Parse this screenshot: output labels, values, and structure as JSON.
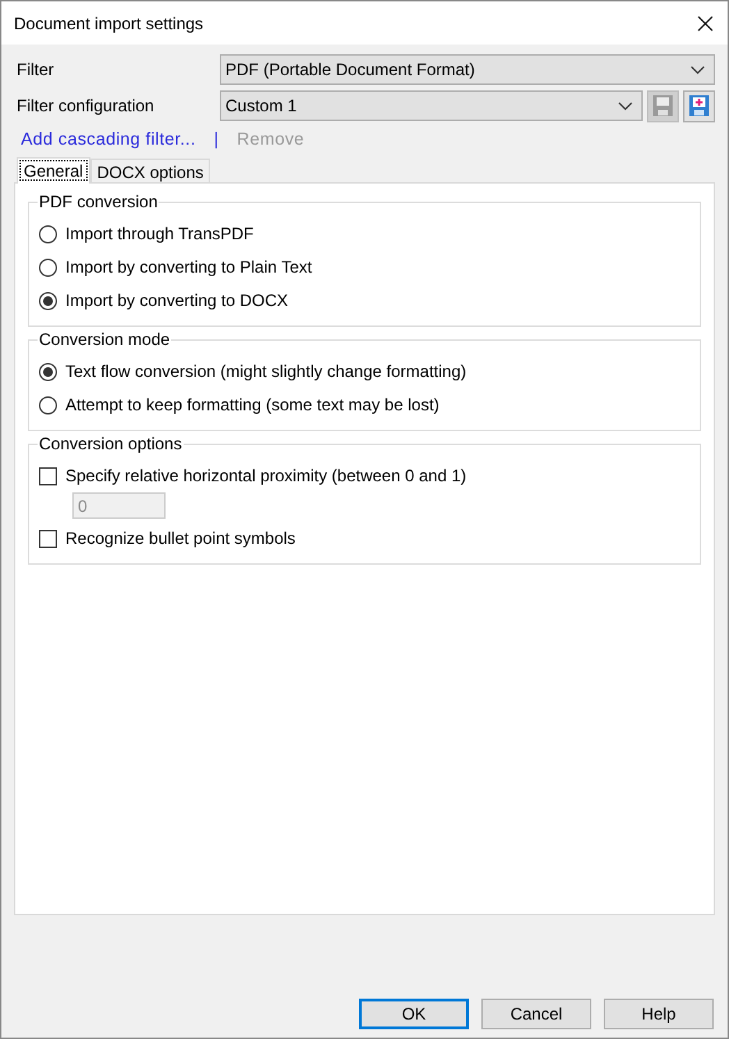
{
  "window": {
    "title": "Document import settings"
  },
  "filter": {
    "label": "Filter",
    "value": "PDF (Portable Document Format)"
  },
  "filter_configuration": {
    "label": "Filter configuration",
    "value": "Custom 1",
    "save_disabled": true
  },
  "links": [
    {
      "label": "Add cascading filter...",
      "disabled": false
    },
    {
      "label": "Remove",
      "disabled": true
    }
  ],
  "link_separator": "|",
  "tabs": [
    {
      "label": "General",
      "selected": true
    },
    {
      "label": "DOCX options",
      "selected": false
    }
  ],
  "groups": [
    {
      "title": "PDF conversion",
      "items": [
        {
          "kind": "radio",
          "label": "Import through TransPDF",
          "selected": false
        },
        {
          "kind": "radio",
          "label": "Import by converting to Plain Text",
          "selected": false
        },
        {
          "kind": "radio",
          "label": "Import by converting to DOCX",
          "selected": true
        }
      ]
    },
    {
      "title": "Conversion mode",
      "items": [
        {
          "kind": "radio",
          "label": "Text flow conversion (might slightly change formatting)",
          "selected": true
        },
        {
          "kind": "radio",
          "label": "Attempt to keep formatting (some text may be lost)",
          "selected": false
        }
      ]
    },
    {
      "title": "Conversion options",
      "items": [
        {
          "kind": "checkbox",
          "label": "Specify relative horizontal proximity (between 0 and 1)",
          "checked": false,
          "field": {
            "value": "0",
            "disabled": true
          }
        },
        {
          "kind": "checkbox",
          "label": "Recognize bullet point symbols",
          "checked": false
        }
      ]
    }
  ],
  "buttons": [
    {
      "label": "OK",
      "default": true
    },
    {
      "label": "Cancel",
      "default": false
    },
    {
      "label": "Help",
      "default": false
    }
  ]
}
